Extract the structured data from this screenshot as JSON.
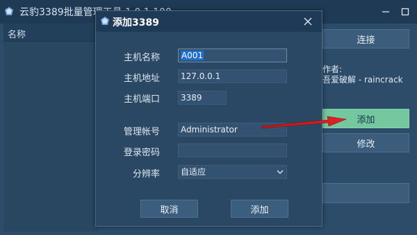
{
  "main": {
    "title": "云豹3389批量管理工具 1.0.1.100",
    "list_header": "名称",
    "connect_label": "连接",
    "author_line1": "作者:",
    "author_line2": "吾爱破解 - raincrack",
    "add_label": "添加",
    "modify_label": "修改",
    "bottom_label": ""
  },
  "dialog": {
    "title": "添加3389",
    "fields": {
      "host_name": {
        "label": "主机名称",
        "value": "A001"
      },
      "host_address": {
        "label": "主机地址",
        "value": "127.0.0.1"
      },
      "host_port": {
        "label": "主机端口",
        "value": "3389"
      },
      "account": {
        "label": "管理帐号",
        "value": "Administrator"
      },
      "password": {
        "label": "登录密码",
        "value": ""
      },
      "resolution": {
        "label": "分辨率",
        "value": "自适应"
      }
    },
    "cancel_label": "取消",
    "add_label": "添加"
  },
  "colors": {
    "background": "#2c4c69",
    "titlebar": "#1f3a55",
    "highlight_button": "#74c79f",
    "arrow": "#d81e1e"
  },
  "icons": {
    "app": "app-logo-icon",
    "close": "close-icon",
    "minimize": "minimize-icon",
    "maximize": "maximize-icon",
    "dropdown": "chevron-down-icon"
  }
}
